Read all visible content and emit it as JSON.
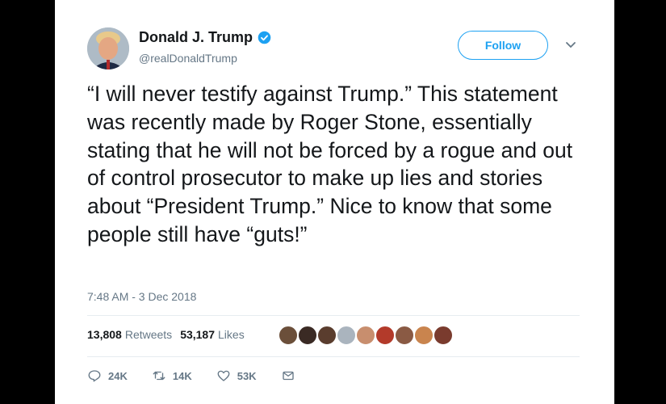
{
  "author": {
    "name": "Donald J. Trump",
    "handle": "@realDonaldTrump",
    "avatar_icon": "profile-photo-icon"
  },
  "follow_label": "Follow",
  "tweet_text": "“I will never testify against Trump.” This statement was recently made by Roger Stone, essentially stating that he will not be forced by a rogue and out of control prosecutor to make up lies and stories about “President Trump.” Nice to know that some people still have “guts!”",
  "timestamp": "7:48 AM - 3 Dec 2018",
  "stats": {
    "retweets_count": "13,808",
    "retweets_label": "Retweets",
    "likes_count": "53,187",
    "likes_label": "Likes"
  },
  "liker_colors": [
    "#6b4f3a",
    "#3a2a24",
    "#5a3d2e",
    "#aab4be",
    "#c88e6e",
    "#b33a2a",
    "#8a5a44",
    "#c9844e",
    "#7a3b2e"
  ],
  "actions": {
    "reply_count": "24K",
    "retweet_count": "14K",
    "like_count": "53K"
  },
  "colors": {
    "accent": "#1da1f2",
    "text": "#14171a",
    "muted": "#657786"
  }
}
